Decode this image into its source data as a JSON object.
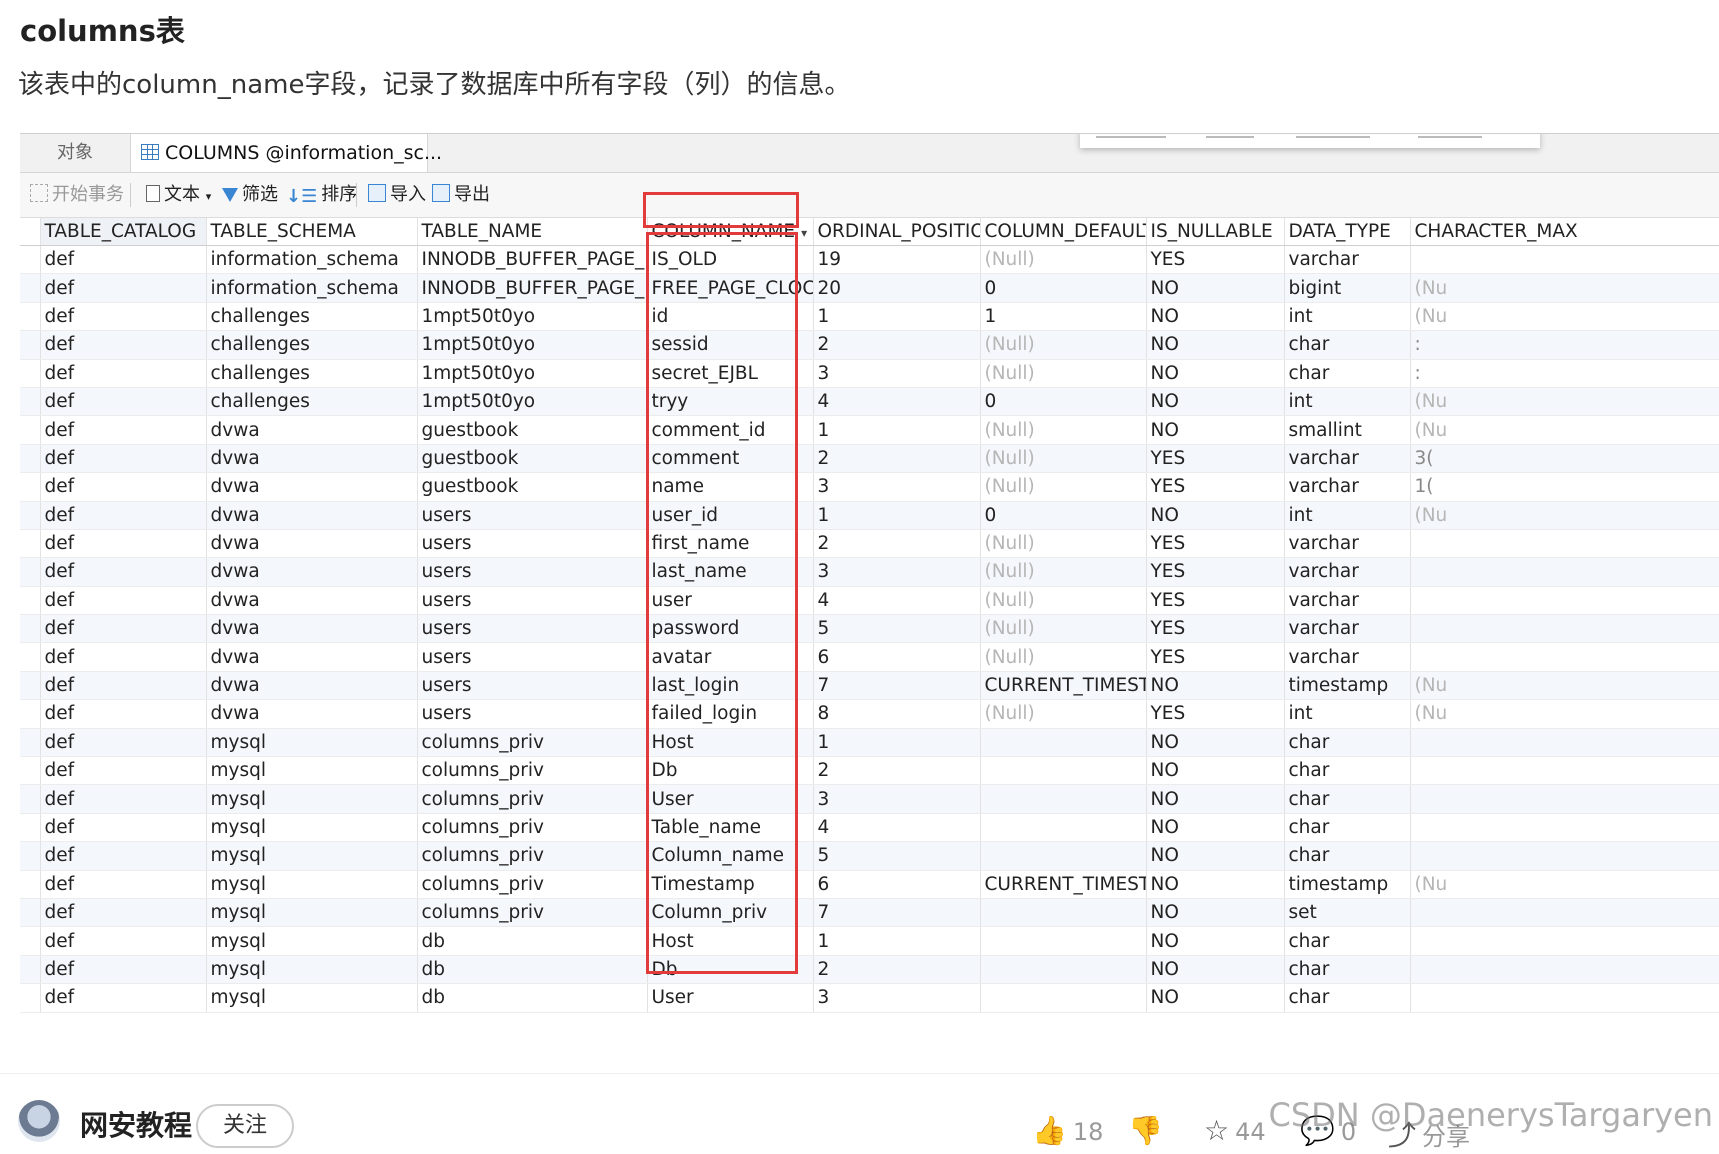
{
  "heading": "columns表",
  "description": "该表中的column_name字段，记录了数据库中所有字段（列）的信息。",
  "tabs": {
    "objects": "对象",
    "active": "COLUMNS @information_sc..."
  },
  "toolbar": {
    "begin_transaction": "开始事务",
    "text": "文本",
    "filter": "筛选",
    "sort": "排序",
    "import": "导入",
    "export": "导出"
  },
  "columns": [
    "TABLE_CATALOG",
    "TABLE_SCHEMA",
    "TABLE_NAME",
    "COLUMN_NAME",
    "ORDINAL_POSITION",
    "COLUMN_DEFAULT",
    "IS_NULLABLE",
    "DATA_TYPE",
    "CHARACTER_MAX"
  ],
  "rows": [
    {
      "c": "def",
      "s": "information_schema",
      "t": "INNODB_BUFFER_PAGE_LRU",
      "n": "IS_OLD",
      "p": "19",
      "d": "(Null)",
      "u": "YES",
      "ty": "varchar",
      "m": ""
    },
    {
      "c": "def",
      "s": "information_schema",
      "t": "INNODB_BUFFER_PAGE_LRU",
      "n": "FREE_PAGE_CLOCK",
      "p": "20",
      "d": "0",
      "u": "NO",
      "ty": "bigint",
      "m": "(Nu"
    },
    {
      "c": "def",
      "s": "challenges",
      "t": "1mpt50t0yo",
      "n": "id",
      "p": "1",
      "d": "1",
      "u": "NO",
      "ty": "int",
      "m": "(Nu"
    },
    {
      "c": "def",
      "s": "challenges",
      "t": "1mpt50t0yo",
      "n": "sessid",
      "p": "2",
      "d": "(Null)",
      "u": "NO",
      "ty": "char",
      "m": ":"
    },
    {
      "c": "def",
      "s": "challenges",
      "t": "1mpt50t0yo",
      "n": "secret_EJBL",
      "p": "3",
      "d": "(Null)",
      "u": "NO",
      "ty": "char",
      "m": ":"
    },
    {
      "c": "def",
      "s": "challenges",
      "t": "1mpt50t0yo",
      "n": "tryy",
      "p": "4",
      "d": "0",
      "u": "NO",
      "ty": "int",
      "m": "(Nu"
    },
    {
      "c": "def",
      "s": "dvwa",
      "t": "guestbook",
      "n": "comment_id",
      "p": "1",
      "d": "(Null)",
      "u": "NO",
      "ty": "smallint",
      "m": "(Nu"
    },
    {
      "c": "def",
      "s": "dvwa",
      "t": "guestbook",
      "n": "comment",
      "p": "2",
      "d": "(Null)",
      "u": "YES",
      "ty": "varchar",
      "m": "3("
    },
    {
      "c": "def",
      "s": "dvwa",
      "t": "guestbook",
      "n": "name",
      "p": "3",
      "d": "(Null)",
      "u": "YES",
      "ty": "varchar",
      "m": "1("
    },
    {
      "c": "def",
      "s": "dvwa",
      "t": "users",
      "n": "user_id",
      "p": "1",
      "d": "0",
      "u": "NO",
      "ty": "int",
      "m": "(Nu"
    },
    {
      "c": "def",
      "s": "dvwa",
      "t": "users",
      "n": "first_name",
      "p": "2",
      "d": "(Null)",
      "u": "YES",
      "ty": "varchar",
      "m": ""
    },
    {
      "c": "def",
      "s": "dvwa",
      "t": "users",
      "n": "last_name",
      "p": "3",
      "d": "(Null)",
      "u": "YES",
      "ty": "varchar",
      "m": ""
    },
    {
      "c": "def",
      "s": "dvwa",
      "t": "users",
      "n": "user",
      "p": "4",
      "d": "(Null)",
      "u": "YES",
      "ty": "varchar",
      "m": ""
    },
    {
      "c": "def",
      "s": "dvwa",
      "t": "users",
      "n": "password",
      "p": "5",
      "d": "(Null)",
      "u": "YES",
      "ty": "varchar",
      "m": ""
    },
    {
      "c": "def",
      "s": "dvwa",
      "t": "users",
      "n": "avatar",
      "p": "6",
      "d": "(Null)",
      "u": "YES",
      "ty": "varchar",
      "m": ""
    },
    {
      "c": "def",
      "s": "dvwa",
      "t": "users",
      "n": "last_login",
      "p": "7",
      "d": "CURRENT_TIMESTAMP",
      "u": "NO",
      "ty": "timestamp",
      "m": "(Nu"
    },
    {
      "c": "def",
      "s": "dvwa",
      "t": "users",
      "n": "failed_login",
      "p": "8",
      "d": "(Null)",
      "u": "YES",
      "ty": "int",
      "m": "(Nu"
    },
    {
      "c": "def",
      "s": "mysql",
      "t": "columns_priv",
      "n": "Host",
      "p": "1",
      "d": "",
      "u": "NO",
      "ty": "char",
      "m": ""
    },
    {
      "c": "def",
      "s": "mysql",
      "t": "columns_priv",
      "n": "Db",
      "p": "2",
      "d": "",
      "u": "NO",
      "ty": "char",
      "m": ""
    },
    {
      "c": "def",
      "s": "mysql",
      "t": "columns_priv",
      "n": "User",
      "p": "3",
      "d": "",
      "u": "NO",
      "ty": "char",
      "m": ""
    },
    {
      "c": "def",
      "s": "mysql",
      "t": "columns_priv",
      "n": "Table_name",
      "p": "4",
      "d": "",
      "u": "NO",
      "ty": "char",
      "m": ""
    },
    {
      "c": "def",
      "s": "mysql",
      "t": "columns_priv",
      "n": "Column_name",
      "p": "5",
      "d": "",
      "u": "NO",
      "ty": "char",
      "m": ""
    },
    {
      "c": "def",
      "s": "mysql",
      "t": "columns_priv",
      "n": "Timestamp",
      "p": "6",
      "d": "CURRENT_TIMESTAMP",
      "u": "NO",
      "ty": "timestamp",
      "m": "(Nu"
    },
    {
      "c": "def",
      "s": "mysql",
      "t": "columns_priv",
      "n": "Column_priv",
      "p": "7",
      "d": "",
      "u": "NO",
      "ty": "set",
      "m": ""
    },
    {
      "c": "def",
      "s": "mysql",
      "t": "db",
      "n": "Host",
      "p": "1",
      "d": "",
      "u": "NO",
      "ty": "char",
      "m": ""
    },
    {
      "c": "def",
      "s": "mysql",
      "t": "db",
      "n": "Db",
      "p": "2",
      "d": "",
      "u": "NO",
      "ty": "char",
      "m": ""
    },
    {
      "c": "def",
      "s": "mysql",
      "t": "db",
      "n": "User",
      "p": "3",
      "d": "",
      "u": "NO",
      "ty": "char",
      "m": ""
    }
  ],
  "bottom": {
    "author": "网安教程",
    "follow": "关注",
    "likes": "18",
    "stars": "44",
    "comments": "0",
    "share": "分享",
    "watermark": "CSDN @DaenerysTargaryen"
  },
  "colors": {
    "highlight": "#e23b3b",
    "accent": "#3a86d3"
  }
}
